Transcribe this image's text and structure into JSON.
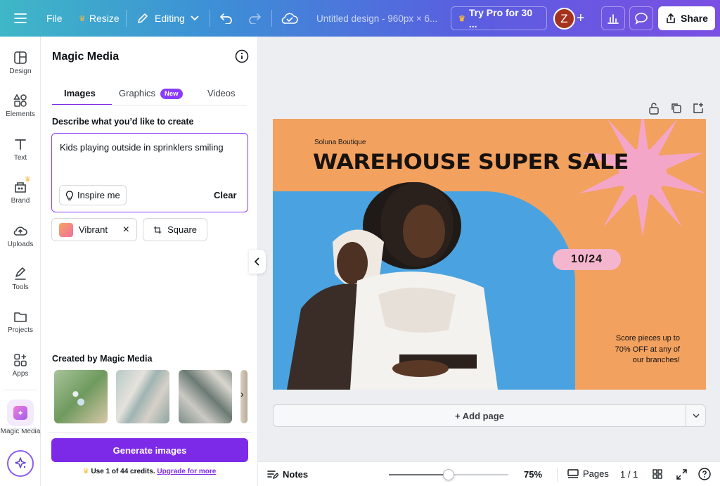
{
  "topbar": {
    "file_label": "File",
    "resize_label": "Resize",
    "editing_label": "Editing",
    "doc_title": "Untitled design - 960px × 6...",
    "try_pro_label": "Try Pro for 30 ...",
    "avatar_initial": "Z",
    "share_label": "Share"
  },
  "rail": {
    "items": [
      {
        "label": "Design",
        "icon": "layout-icon"
      },
      {
        "label": "Elements",
        "icon": "shapes-icon"
      },
      {
        "label": "Text",
        "icon": "text-icon"
      },
      {
        "label": "Brand",
        "icon": "brand-icon"
      },
      {
        "label": "Uploads",
        "icon": "cloud-upload-icon"
      },
      {
        "label": "Tools",
        "icon": "pen-icon"
      },
      {
        "label": "Projects",
        "icon": "folder-icon"
      },
      {
        "label": "Apps",
        "icon": "apps-icon"
      },
      {
        "label": "Magic Media",
        "icon": "magic-media-icon"
      }
    ]
  },
  "panel": {
    "title": "Magic Media",
    "tabs": [
      {
        "label": "Images"
      },
      {
        "label": "Graphics",
        "badge": "New"
      },
      {
        "label": "Videos"
      }
    ],
    "prompt_label": "Describe what you’d like to create",
    "prompt_value": "Kids playing outside in sprinklers smiling",
    "inspire_label": "Inspire me",
    "clear_label": "Clear",
    "style_label": "Vibrant",
    "ratio_label": "Square",
    "created_label": "Created by Magic Media",
    "generate_label": "Generate images",
    "credits_text": "Use 1 of 44 credits.",
    "upgrade_link": "Upgrade for more"
  },
  "design": {
    "brand": "Soluna Boutique",
    "headline": "WAREHOUSE SUPER SALE",
    "date": "10/24",
    "promo_line1": "Score pieces up to",
    "promo_line2": "70% OFF at any of",
    "promo_line3": "our branches!"
  },
  "canvas": {
    "add_page_label": "+ Add page"
  },
  "bottombar": {
    "notes_label": "Notes",
    "zoom_value": "75%",
    "zoom_fraction": 0.5,
    "pages_label": "Pages",
    "page_count": "1 / 1"
  },
  "colors": {
    "accent": "#7d2ae8",
    "design_orange": "#f2a15f",
    "design_blue": "#4aa3e0",
    "sun_pink": "#f4a6c8",
    "date_pill": "#f4b6cf"
  }
}
